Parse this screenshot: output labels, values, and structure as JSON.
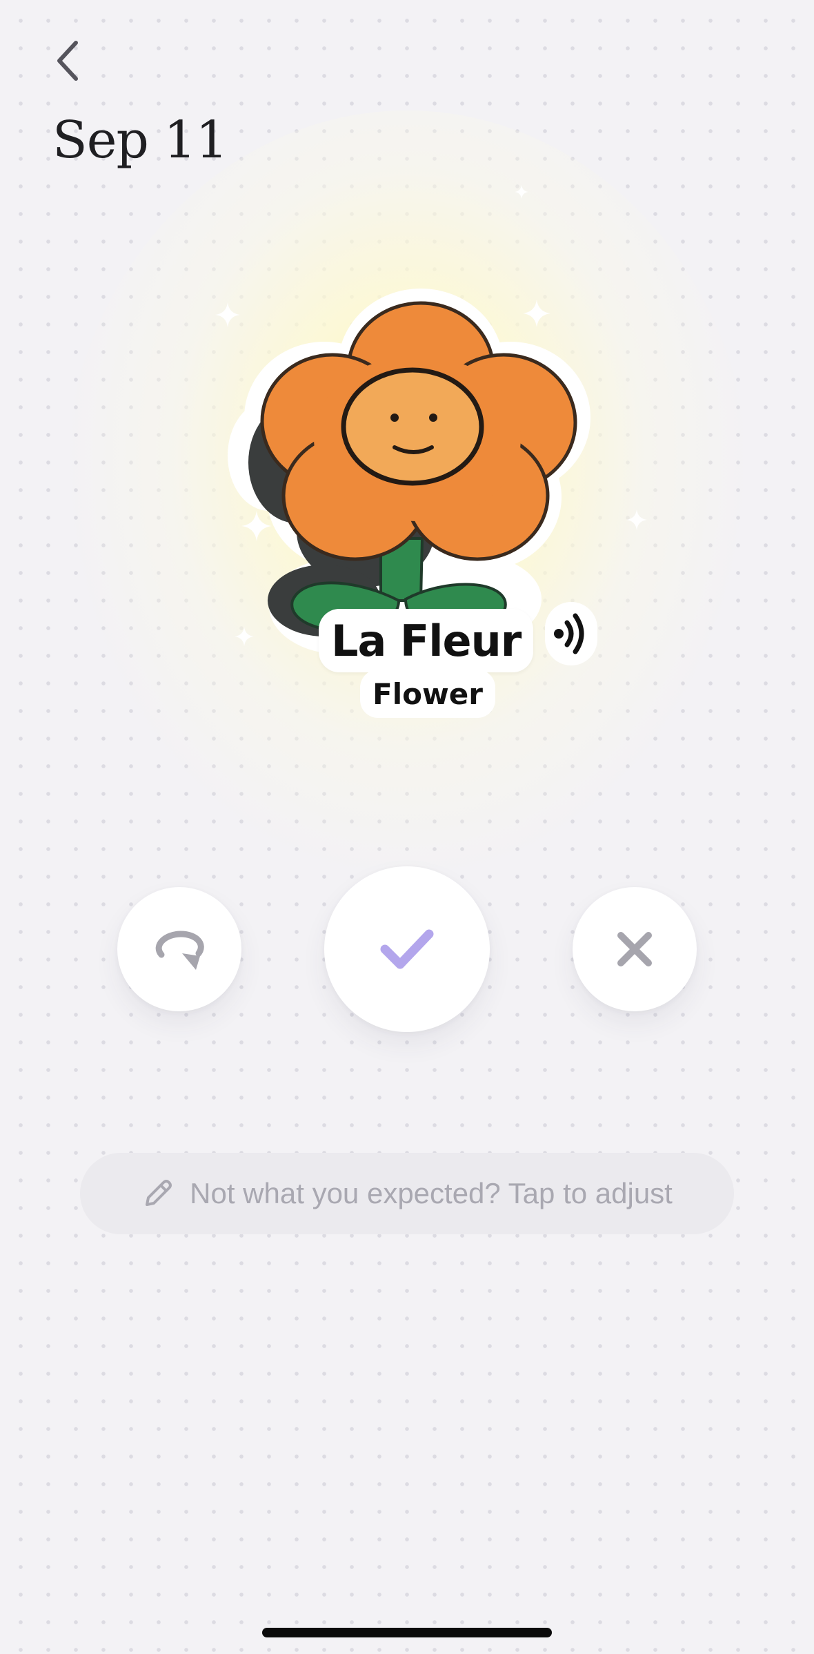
{
  "header": {
    "title": "Sep 11"
  },
  "card": {
    "word": "La Fleur",
    "translation": "Flower",
    "image": "flower-sticker"
  },
  "actions": {
    "retry_icon": "retry-icon",
    "confirm_icon": "checkmark-icon",
    "dismiss_icon": "close-icon"
  },
  "adjust": {
    "label": "Not what you expected? Tap to adjust",
    "icon": "pencil-icon"
  },
  "colors": {
    "accent": "#b3a6ec",
    "flower_petals": "#ee8a3a",
    "flower_face": "#f2a958",
    "stem_leaves": "#2f8a4e",
    "muted_icon": "#a6a5ad"
  }
}
